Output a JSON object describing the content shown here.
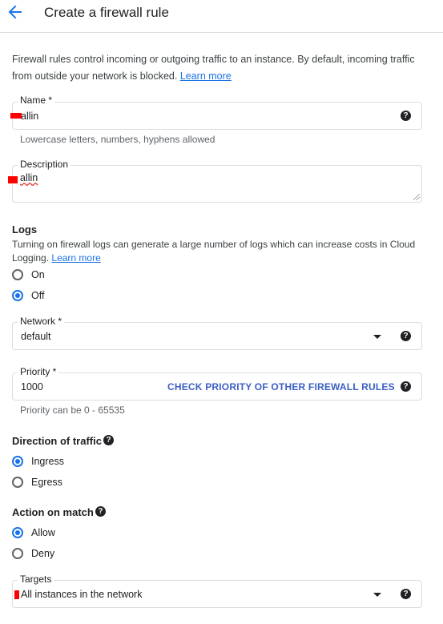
{
  "header": {
    "title": "Create a firewall rule",
    "back_icon": "arrow-back-icon"
  },
  "intro": {
    "text": "Firewall rules control incoming or outgoing traffic to an instance. By default, incoming traffic from outside your network is blocked.",
    "link": "Learn more"
  },
  "name_field": {
    "label": "Name *",
    "value": "allin",
    "hint": "Lowercase letters, numbers, hyphens allowed"
  },
  "description_field": {
    "label": "Description",
    "value": "allin"
  },
  "logs": {
    "title": "Logs",
    "text": "Turning on firewall logs can generate a large number of logs which can increase costs in Cloud Logging.",
    "link": "Learn more",
    "options": [
      {
        "label": "On",
        "selected": false
      },
      {
        "label": "Off",
        "selected": true
      }
    ]
  },
  "network_field": {
    "label": "Network *",
    "value": "default"
  },
  "priority_field": {
    "label": "Priority *",
    "value": "1000",
    "action": "CHECK PRIORITY OF OTHER FIREWALL RULES",
    "hint": "Priority can be 0 - 65535"
  },
  "direction": {
    "title": "Direction of traffic",
    "options": [
      {
        "label": "Ingress",
        "selected": true
      },
      {
        "label": "Egress",
        "selected": false
      }
    ]
  },
  "action_on_match": {
    "title": "Action on match",
    "options": [
      {
        "label": "Allow",
        "selected": true
      },
      {
        "label": "Deny",
        "selected": false
      }
    ]
  },
  "targets_field": {
    "label": "Targets",
    "value": "All instances in the network"
  },
  "help_glyph": "?",
  "colors": {
    "accent": "#1a73e8",
    "link_action": "#3b5fc4",
    "redaction": "#ff0000"
  }
}
